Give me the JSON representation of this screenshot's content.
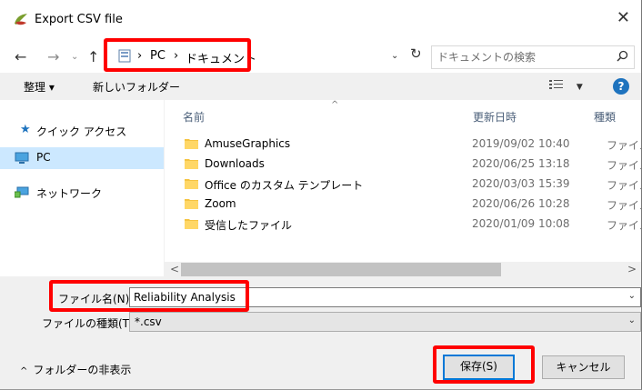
{
  "window": {
    "title": "Export CSV file",
    "close_glyph": "✕"
  },
  "address_bar": {
    "back_glyph": "←",
    "forward_glyph": "→",
    "dropdown_glyph": "⌄",
    "up_glyph": "↑",
    "breadcrumbs": [
      "PC",
      "ドキュメント"
    ],
    "separator": "›",
    "refresh_glyph": "↻",
    "search_placeholder": "ドキュメントの検索"
  },
  "toolbar": {
    "organize_label": "整理 ▾",
    "new_folder_label": "新しいフォルダー",
    "help_label": "?"
  },
  "nav_pane": {
    "items": [
      {
        "label": "クイック アクセス",
        "icon": "star-icon",
        "color": "#1e73be"
      },
      {
        "label": "PC",
        "icon": "pc-icon",
        "selected": true
      },
      {
        "label": "ネットワーク",
        "icon": "network-icon"
      }
    ]
  },
  "file_list": {
    "columns": [
      "名前",
      "更新日時",
      "種類"
    ],
    "files": [
      {
        "name": "AmuseGraphics",
        "modified": "2019/09/02 10:40",
        "type": "ファイル"
      },
      {
        "name": "Downloads",
        "modified": "2020/06/25 13:18",
        "type": "ファイル"
      },
      {
        "name": "Office のカスタム テンプレート",
        "modified": "2020/03/03 15:39",
        "type": "ファイル"
      },
      {
        "name": "Zoom",
        "modified": "2020/06/26 10:28",
        "type": "ファイル"
      },
      {
        "name": "受信したファイル",
        "modified": "2020/01/09 10:08",
        "type": "ファイル"
      }
    ]
  },
  "form": {
    "filename_label": "ファイル名(N):",
    "filename_value": "Reliability Analysis",
    "filetype_label": "ファイルの種類(T):",
    "filetype_value": "*.csv"
  },
  "footer": {
    "hide_folders_label": "フォルダーの非表示",
    "save_label": "保存(S)",
    "cancel_label": "キャンセル"
  },
  "colors": {
    "highlight_red": "#ff0000",
    "folder": "#f5c342",
    "accent": "#0078d7"
  }
}
